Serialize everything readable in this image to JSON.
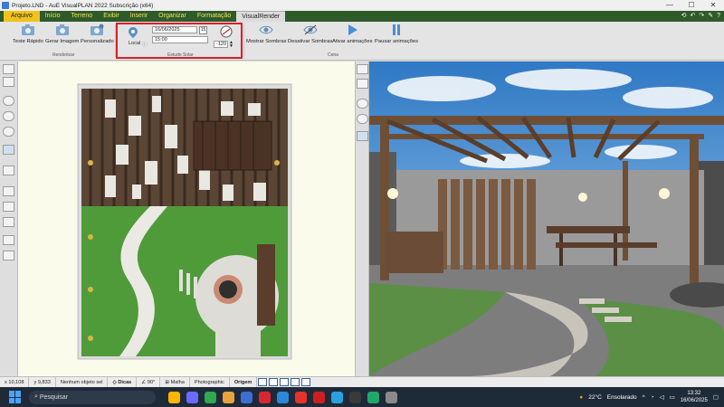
{
  "window": {
    "title": "Projeto.LND - AuE VisualPLAN 2022 Subscrição (x64)",
    "controls": [
      "—",
      "☐",
      "✕"
    ]
  },
  "menu": {
    "items": [
      "Arquivo",
      "Início",
      "Terreno",
      "Exibir",
      "Inserir",
      "Organizar",
      "Formatação",
      "VisualRender"
    ],
    "active": "VisualRender",
    "quick_access": [
      "⟲",
      "↶",
      "↷",
      "✎",
      "?"
    ]
  },
  "ribbon": {
    "render_group": {
      "buttons": [
        "Teste Rápido",
        "Gerar Imagem",
        "Personalizado"
      ],
      "label": "Renderizar"
    },
    "solar_group": {
      "local_label": "Local",
      "date_value": "16/06/2025",
      "date_badge": "15",
      "time_value": "15:00",
      "angle_value": "-120",
      "label": "Estudo Solar"
    },
    "scene_group": {
      "buttons": [
        "Mostrar Sombras",
        "Desativar Sombras",
        "Ativar animações",
        "Pausar animações"
      ],
      "label": "Cena"
    }
  },
  "status": {
    "coord_x": "x 10,108",
    "coord_y": "y 9,833",
    "selection": "Nenhum objeto sel",
    "tips": "Dicas",
    "angle": "90°",
    "grid": "Malha",
    "mode": "Photographic",
    "origin": "Origem"
  },
  "taskbar": {
    "search_placeholder": "Pesquisar",
    "weather_temp": "22°C",
    "weather_text": "Ensolarado",
    "time": "13:32",
    "date": "16/06/2025"
  }
}
